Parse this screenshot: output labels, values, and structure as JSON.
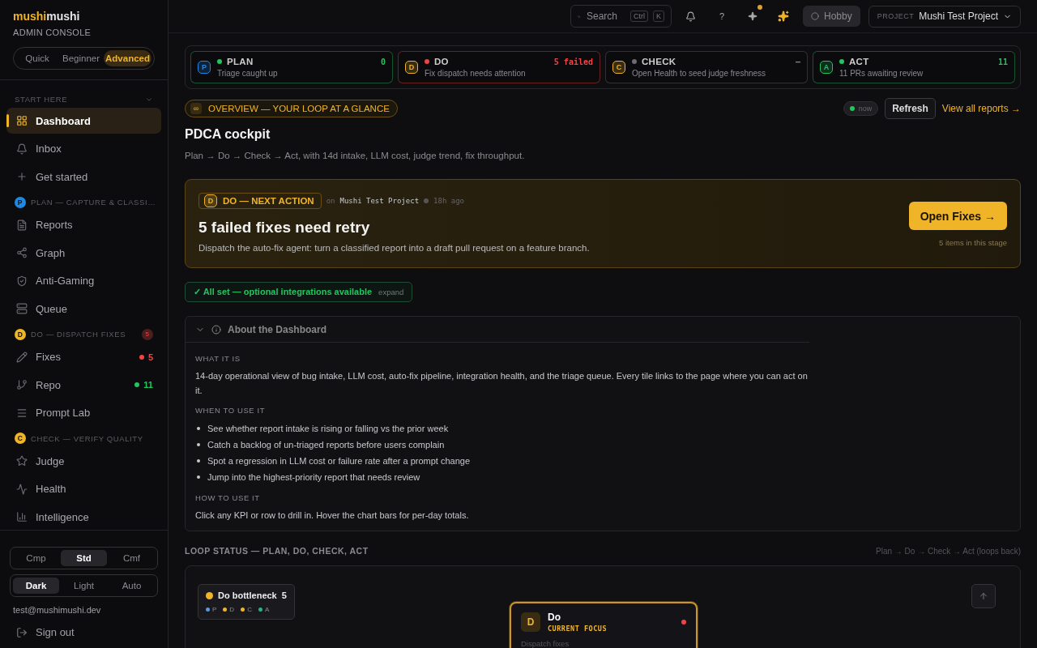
{
  "brand": {
    "name_a": "mushi",
    "name_b": "mushi",
    "subtitle": "ADMIN CONSOLE"
  },
  "modes": [
    {
      "label": "Quick",
      "selected": false
    },
    {
      "label": "Beginner",
      "selected": false
    },
    {
      "label": "Advanced",
      "selected": true
    }
  ],
  "nav_sections": [
    {
      "title": "START HERE",
      "expanded": true,
      "items": [
        {
          "label": "Dashboard",
          "selected": true
        },
        {
          "label": "Inbox",
          "selected": false
        },
        {
          "label": "Get started",
          "selected": false
        }
      ]
    },
    {
      "title": "PLAN — CAPTURE & CLASSI…",
      "letter": "P",
      "color": "#1e88e5",
      "items": [
        {
          "label": "Reports",
          "selected": false
        },
        {
          "label": "Graph",
          "selected": false
        },
        {
          "label": "Anti-Gaming",
          "selected": false
        },
        {
          "label": "Queue",
          "selected": false
        }
      ]
    },
    {
      "title": "DO — DISPATCH FIXES",
      "letter": "D",
      "color": "#f0b429",
      "count": "5",
      "items": [
        {
          "label": "Fixes",
          "selected": false,
          "count": "5",
          "color": "#ef4444"
        },
        {
          "label": "Repo",
          "selected": false,
          "count": "11",
          "color": "#22c55e"
        },
        {
          "label": "Prompt Lab",
          "selected": false
        }
      ]
    },
    {
      "title": "CHECK — VERIFY QUALITY",
      "letter": "C",
      "color": "#f0b429",
      "items": [
        {
          "label": "Judge",
          "selected": false
        },
        {
          "label": "Health",
          "selected": false
        },
        {
          "label": "Intelligence",
          "selected": false
        }
      ]
    }
  ],
  "density": [
    {
      "label": "Cmp",
      "selected": false
    },
    {
      "label": "Std",
      "selected": true
    },
    {
      "label": "Cmf",
      "selected": false
    }
  ],
  "theme": [
    {
      "label": "Dark",
      "selected": true
    },
    {
      "label": "Light",
      "selected": false
    },
    {
      "label": "Auto",
      "selected": false
    }
  ],
  "user_email": "test@mushimushi.dev",
  "sign_out": "Sign out",
  "topbar": {
    "search": {
      "placeholder": "Search",
      "keys": [
        "Ctrl",
        "K"
      ]
    },
    "help": "?",
    "plan": "Hobby",
    "project_label": "PROJECT",
    "project": "Mushi Test Project"
  },
  "stages": [
    {
      "badge": {
        "letter": "P",
        "color": "#1e88e5"
      },
      "title": "PLAN",
      "color": "#22c55e",
      "count": "0",
      "desc": "Triage caught up"
    },
    {
      "badge": {
        "letter": "D",
        "color": "#f0b429"
      },
      "title": "DO",
      "color": "#ef4444",
      "count": "5 failed",
      "desc": "Fix dispatch needs attention"
    },
    {
      "badge": {
        "letter": "C",
        "color": "#f0b429"
      },
      "title": "CHECK",
      "color": "#6b6b70",
      "count": "–",
      "desc": "Open Health to seed judge freshness"
    },
    {
      "badge": {
        "letter": "A",
        "color": "#22c55e"
      },
      "title": "ACT",
      "color": "#22c55e",
      "count": "11",
      "desc": "11 PRs awaiting review"
    }
  ],
  "overview": {
    "icon_text": "∞",
    "label": "OVERVIEW — YOUR LOOP AT A GLANCE",
    "title": "PDCA cockpit",
    "subtitle": "Plan → Do → Check → Act, with 14d intake, LLM cost, judge trend, fix throughput.",
    "freshness": "now",
    "refresh": "Refresh",
    "view_all": "View all reports →"
  },
  "next_action": {
    "letter": "D",
    "label": "DO — NEXT ACTION",
    "on": "on",
    "project": "Mushi Test Project",
    "age": "18h ago",
    "title": "5 failed fixes need retry",
    "desc": "Dispatch the auto-fix agent: turn a classified report into a draft pull request on a feature branch.",
    "button": "Open Fixes →",
    "note": "5 items in this stage"
  },
  "integrations": {
    "label": "✓ All set — optional integrations available",
    "action": "expand"
  },
  "about": {
    "title": "About the Dashboard",
    "expanded": true,
    "sections": [
      {
        "kind": "text",
        "heading": "WHAT IT IS",
        "text": "14-day operational view of bug intake, LLM cost, auto-fix pipeline, integration health, and the triage queue. Every tile links to the page where you can act on it."
      },
      {
        "kind": "list",
        "heading": "WHEN TO USE IT",
        "items": [
          "See whether report intake is rising or falling vs the prior week",
          "Catch a backlog of un-triaged reports before users complain",
          "Spot a regression in LLM cost or failure rate after a prompt change",
          "Jump into the highest-priority report that needs review"
        ]
      },
      {
        "kind": "text",
        "heading": "HOW TO USE IT",
        "text": "Click any KPI or row to drill in. Hover the chart bars for per-day totals."
      }
    ]
  },
  "loop": {
    "heading": "LOOP STATUS — PLAN, DO, CHECK, ACT",
    "hint": "Plan → Do → Check → Act (loops back)",
    "bottleneck": {
      "label": "Do bottleneck",
      "count": "5",
      "color": "#f0b429",
      "legend": [
        {
          "label": "P",
          "color": "#5b9bd5"
        },
        {
          "label": "D",
          "color": "#f0b429"
        },
        {
          "label": "C",
          "color": "#f0b429"
        },
        {
          "label": "A",
          "color": "#22b38a"
        }
      ]
    },
    "node": {
      "letter": "D",
      "title": "Do",
      "tag": "CURRENT FOCUS",
      "color": "#ef4444",
      "desc": "Dispatch fixes"
    }
  }
}
